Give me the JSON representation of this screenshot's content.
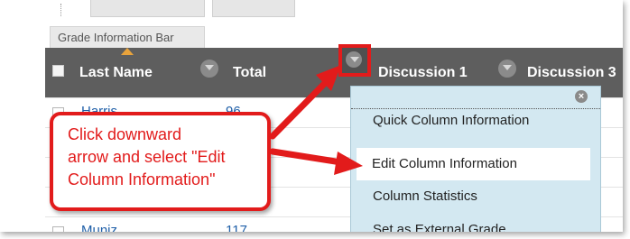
{
  "grade_bar": {
    "label": "Grade Information Bar"
  },
  "headers": {
    "last_name": "Last Name",
    "total": "Total",
    "discussion1": "Discussion 1",
    "discussion3": "Discussion 3"
  },
  "rows": [
    {
      "last": "Harris",
      "total": "96"
    },
    {
      "last": "Muniz",
      "total": "117"
    }
  ],
  "menu": {
    "items": [
      {
        "label": "Quick Column Information"
      },
      {
        "label": "Edit Column Information"
      },
      {
        "label": "Column Statistics"
      },
      {
        "label": "Set as External Grade"
      }
    ]
  },
  "callout": {
    "lines": [
      "Click downward",
      "arrow and select \"Edit",
      "Column Information\""
    ]
  },
  "colors": {
    "header": "#5e5e5e",
    "menu": "#d3e8f1",
    "annotation_red": "#e21b1b",
    "link": "#1f5fa8"
  }
}
